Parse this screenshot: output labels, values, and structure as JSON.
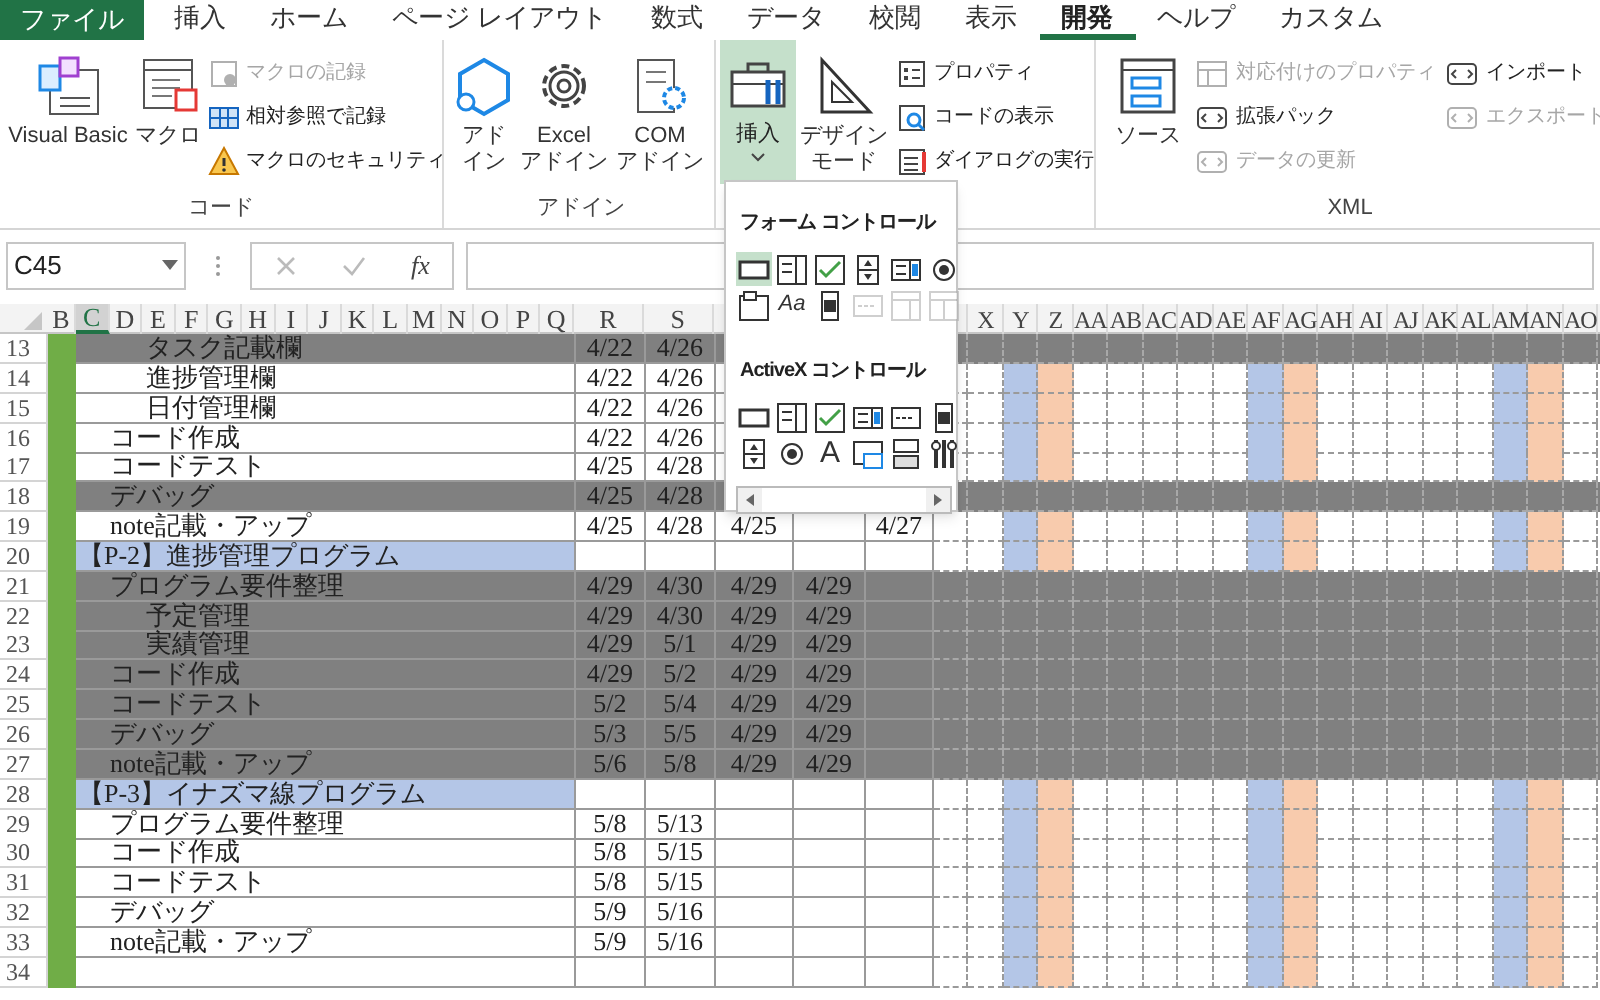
{
  "ribbon_tabs": [
    {
      "label": "ファイル",
      "kind": "file",
      "selected": false
    },
    {
      "label": "挿入",
      "kind": "tab",
      "selected": false
    },
    {
      "label": "ホーム",
      "kind": "tab",
      "selected": false
    },
    {
      "label": "ページ レイアウト",
      "kind": "tab",
      "selected": false
    },
    {
      "label": "数式",
      "kind": "tab",
      "selected": false
    },
    {
      "label": "データ",
      "kind": "tab",
      "selected": false
    },
    {
      "label": "校閲",
      "kind": "tab",
      "selected": false
    },
    {
      "label": "表示",
      "kind": "tab",
      "selected": false
    },
    {
      "label": "開発",
      "kind": "tab",
      "selected": true
    },
    {
      "label": "ヘルプ",
      "kind": "tab",
      "selected": false
    },
    {
      "label": "カスタム",
      "kind": "tab",
      "selected": false
    }
  ],
  "code_group": {
    "label": "コード",
    "large_buttons": [
      {
        "label": "Visual Basic"
      },
      {
        "label": "マクロ"
      }
    ],
    "commands": [
      {
        "label": "マクロの記録",
        "disabled": true
      },
      {
        "label": "相対参照で記録",
        "disabled": false
      },
      {
        "label": "マクロのセキュリティ",
        "disabled": false
      }
    ]
  },
  "addins_group": {
    "label": "アドイン",
    "large_buttons": [
      {
        "label": "アドイン"
      },
      {
        "label": "Excel アドイン"
      },
      {
        "label": "COM アドイン"
      }
    ]
  },
  "controls_group": {
    "insert": {
      "label": "挿入",
      "pressed": true
    },
    "design_mode": {
      "label": "デザインモード"
    },
    "commands": [
      {
        "label": "プロパティ",
        "disabled": false
      },
      {
        "label": "コードの表示",
        "disabled": false
      },
      {
        "label": "ダイアログの実行",
        "disabled": false
      }
    ]
  },
  "xml_group": {
    "label": "XML",
    "source": {
      "label": "ソース"
    },
    "commands": [
      {
        "label": "対応付けのプロパティ",
        "disabled": true
      },
      {
        "label": "拡張パック",
        "disabled": false
      },
      {
        "label": "データの更新",
        "disabled": true
      }
    ],
    "commands_2": [
      {
        "label": "インポート",
        "disabled": false
      },
      {
        "label": "エクスポート",
        "disabled": true
      }
    ]
  },
  "formula_bar": {
    "name_box": "C45",
    "function_label": "fx"
  },
  "insert_menu": {
    "sections": [
      {
        "title": "フォーム コントロール",
        "controls": [
          {
            "kind": "button",
            "selected": true,
            "disabled": false
          },
          {
            "kind": "combo",
            "selected": false,
            "disabled": false
          },
          {
            "kind": "check",
            "selected": false,
            "disabled": false
          },
          {
            "kind": "spin",
            "selected": false,
            "disabled": false
          },
          {
            "kind": "list",
            "selected": false,
            "disabled": false
          },
          {
            "kind": "option",
            "selected": false,
            "disabled": false
          },
          {
            "kind": "group",
            "selected": false,
            "disabled": false
          },
          {
            "kind": "label",
            "glyph": "Aa",
            "selected": false,
            "disabled": false
          },
          {
            "kind": "scroll",
            "selected": false,
            "disabled": false
          },
          {
            "kind": "textfield",
            "selected": false,
            "disabled": true
          },
          {
            "kind": "combolist",
            "selected": false,
            "disabled": true
          },
          {
            "kind": "combodrop",
            "selected": false,
            "disabled": true
          }
        ]
      },
      {
        "title": "ActiveX コントロール",
        "controls": [
          {
            "kind": "button",
            "selected": false,
            "disabled": false
          },
          {
            "kind": "combo",
            "selected": false,
            "disabled": false
          },
          {
            "kind": "check",
            "selected": false,
            "disabled": false
          },
          {
            "kind": "list",
            "selected": false,
            "disabled": false
          },
          {
            "kind": "textfield",
            "selected": false,
            "disabled": false
          },
          {
            "kind": "scroll",
            "selected": false,
            "disabled": false
          },
          {
            "kind": "spin",
            "selected": false,
            "disabled": false
          },
          {
            "kind": "option",
            "selected": false,
            "disabled": false
          },
          {
            "kind": "label",
            "glyph": "A",
            "selected": false,
            "disabled": false
          },
          {
            "kind": "image",
            "selected": false,
            "disabled": false
          },
          {
            "kind": "toggle",
            "selected": false,
            "disabled": false
          },
          {
            "kind": "more",
            "selected": false,
            "disabled": false
          }
        ]
      }
    ]
  },
  "sheet": {
    "columns_left": [
      {
        "label": "B",
        "selected": false
      },
      {
        "label": "C",
        "selected": true
      },
      {
        "label": "D",
        "selected": false
      },
      {
        "label": "E",
        "selected": false
      },
      {
        "label": "F",
        "selected": false
      },
      {
        "label": "G",
        "selected": false
      },
      {
        "label": "H",
        "selected": false
      },
      {
        "label": "I",
        "selected": false
      },
      {
        "label": "J",
        "selected": false
      },
      {
        "label": "K",
        "selected": false
      },
      {
        "label": "L",
        "selected": false
      },
      {
        "label": "M",
        "selected": false
      },
      {
        "label": "N",
        "selected": false
      },
      {
        "label": "O",
        "selected": false
      },
      {
        "label": "P",
        "selected": false
      },
      {
        "label": "Q",
        "selected": false
      },
      {
        "label": "R",
        "selected": false
      },
      {
        "label": "S",
        "selected": false
      }
    ],
    "timeline_columns": [
      {
        "label": "X"
      },
      {
        "label": "Y",
        "color": "#b4c6e7"
      },
      {
        "label": "Z",
        "color": "#f8cbad"
      },
      {
        "label": "AA"
      },
      {
        "label": "AB"
      },
      {
        "label": "AC"
      },
      {
        "label": "AD"
      },
      {
        "label": "AE"
      },
      {
        "label": "AF",
        "color": "#b4c6e7"
      },
      {
        "label": "AG",
        "color": "#f8cbad"
      },
      {
        "label": "AH"
      },
      {
        "label": "AI"
      },
      {
        "label": "AJ"
      },
      {
        "label": "AK"
      },
      {
        "label": "AL"
      },
      {
        "label": "AM",
        "color": "#b4c6e7"
      },
      {
        "label": "AN",
        "color": "#f8cbad"
      },
      {
        "label": "AO"
      }
    ],
    "rows": [
      {
        "number": "13",
        "kind": "subtask",
        "name": "タスク記載欄",
        "shaded": true,
        "dates": {
          "R": "4/22",
          "S": "4/26"
        }
      },
      {
        "number": "14",
        "kind": "subtask",
        "name": "進捗管理欄",
        "shaded": false,
        "dates": {
          "R": "4/22",
          "S": "4/26"
        }
      },
      {
        "number": "15",
        "kind": "subtask",
        "name": "日付管理欄",
        "shaded": false,
        "dates": {
          "R": "4/22",
          "S": "4/26"
        }
      },
      {
        "number": "16",
        "kind": "task",
        "name": "コード作成",
        "shaded": false,
        "dates": {
          "R": "4/22",
          "S": "4/26"
        }
      },
      {
        "number": "17",
        "kind": "task",
        "name": "コードテスト",
        "shaded": false,
        "dates": {
          "R": "4/25",
          "S": "4/28"
        }
      },
      {
        "number": "18",
        "kind": "task",
        "name": "デバッグ",
        "shaded": true,
        "dates": {
          "R": "4/25",
          "S": "4/28"
        }
      },
      {
        "number": "19",
        "kind": "task",
        "name": "note記載・アップ",
        "shaded": false,
        "dates": {
          "R": "4/25",
          "S": "4/28",
          "T": "4/25",
          "V": "4/27"
        }
      },
      {
        "number": "20",
        "kind": "project",
        "name": "【P-2】進捗管理プログラム",
        "shaded": false
      },
      {
        "number": "21",
        "kind": "task",
        "name": "プログラム要件整理",
        "shaded": true,
        "dates": {
          "R": "4/29",
          "S": "4/30",
          "T": "4/29",
          "U": "4/29"
        }
      },
      {
        "number": "22",
        "kind": "subtask",
        "name": "予定管理",
        "shaded": true,
        "dates": {
          "R": "4/29",
          "S": "4/30",
          "T": "4/29",
          "U": "4/29"
        }
      },
      {
        "number": "23",
        "kind": "subtask",
        "name": "実績管理",
        "shaded": true,
        "dates": {
          "R": "4/29",
          "S": "5/1",
          "T": "4/29",
          "U": "4/29"
        }
      },
      {
        "number": "24",
        "kind": "task",
        "name": "コード作成",
        "shaded": true,
        "dates": {
          "R": "4/29",
          "S": "5/2",
          "T": "4/29",
          "U": "4/29"
        }
      },
      {
        "number": "25",
        "kind": "task",
        "name": "コードテスト",
        "shaded": true,
        "dates": {
          "R": "5/2",
          "S": "5/4",
          "T": "4/29",
          "U": "4/29"
        }
      },
      {
        "number": "26",
        "kind": "task",
        "name": "デバッグ",
        "shaded": true,
        "dates": {
          "R": "5/3",
          "S": "5/5",
          "T": "4/29",
          "U": "4/29"
        }
      },
      {
        "number": "27",
        "kind": "task",
        "name": "note記載・アップ",
        "shaded": true,
        "dates": {
          "R": "5/6",
          "S": "5/8",
          "T": "4/29",
          "U": "4/29"
        }
      },
      {
        "number": "28",
        "kind": "project",
        "name": "【P-3】イナズマ線プログラム",
        "shaded": false
      },
      {
        "number": "29",
        "kind": "task",
        "name": "プログラム要件整理",
        "shaded": false,
        "dates": {
          "R": "5/8",
          "S": "5/13"
        }
      },
      {
        "number": "30",
        "kind": "task",
        "name": "コード作成",
        "shaded": false,
        "dates": {
          "R": "5/8",
          "S": "5/15"
        }
      },
      {
        "number": "31",
        "kind": "task",
        "name": "コードテスト",
        "shaded": false,
        "dates": {
          "R": "5/8",
          "S": "5/15"
        }
      },
      {
        "number": "32",
        "kind": "task",
        "name": "デバッグ",
        "shaded": false,
        "dates": {
          "R": "5/9",
          "S": "5/16"
        }
      },
      {
        "number": "33",
        "kind": "task",
        "name": "note記載・アップ",
        "shaded": false,
        "dates": {
          "R": "5/9",
          "S": "5/16"
        }
      },
      {
        "number": "34",
        "kind": "blank",
        "shaded": false
      }
    ]
  }
}
